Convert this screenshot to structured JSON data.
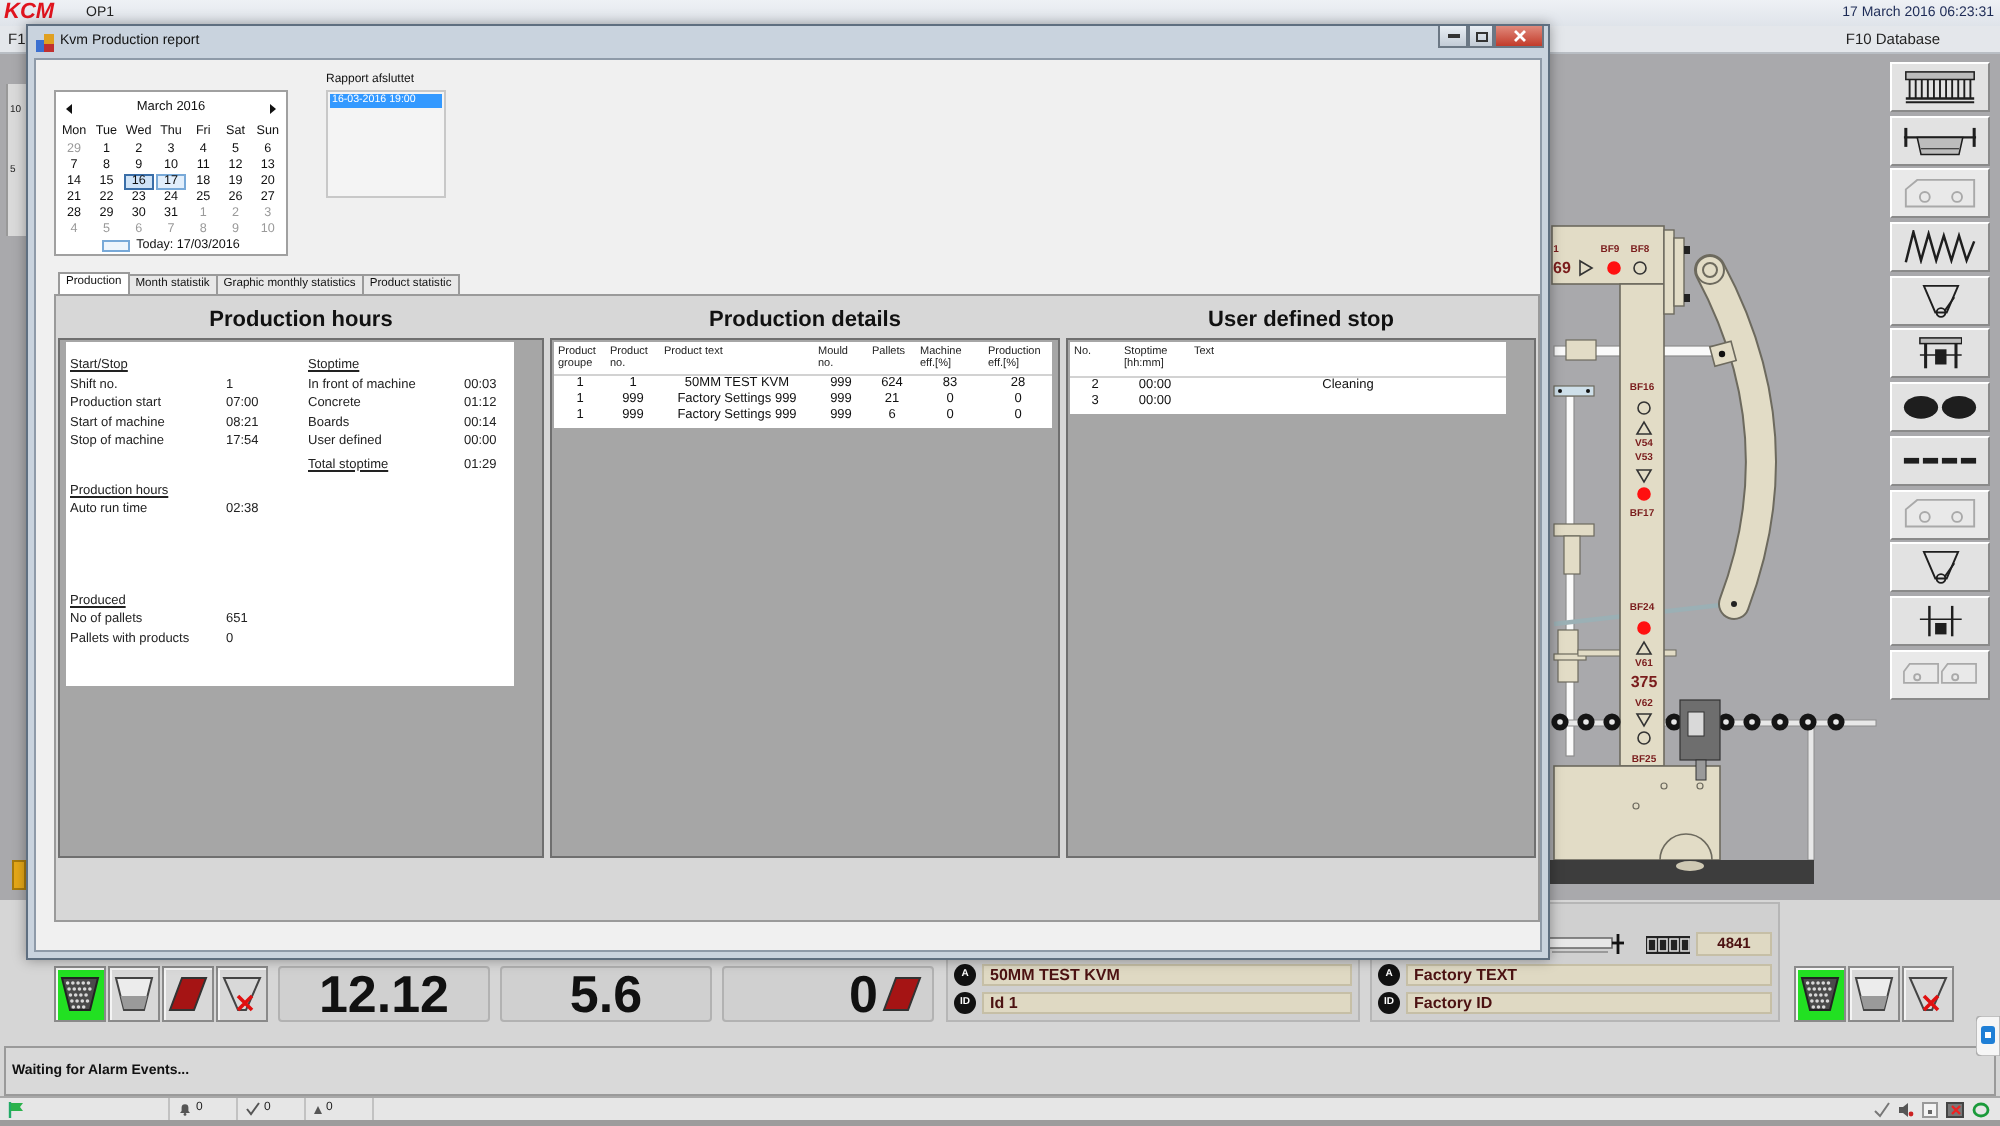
{
  "app_bar": {
    "logo": "KCM",
    "station": "OP1",
    "datetime": "17 March 2016 06:23:31"
  },
  "function_bar": {
    "left_key": "F1",
    "right_key": "F10 Database"
  },
  "dialog": {
    "title": "Kvm Production report",
    "calendar": {
      "month": "March 2016",
      "weekdays": [
        "Mon",
        "Tue",
        "Wed",
        "Thu",
        "Fri",
        "Sat",
        "Sun"
      ],
      "weeks": [
        [
          {
            "day": "29",
            "other_month": true,
            "selected": false,
            "today": false
          },
          {
            "day": "1",
            "other_month": false,
            "selected": false,
            "today": false
          },
          {
            "day": "2",
            "other_month": false,
            "selected": false,
            "today": false
          },
          {
            "day": "3",
            "other_month": false,
            "selected": false,
            "today": false
          },
          {
            "day": "4",
            "other_month": false,
            "selected": false,
            "today": false
          },
          {
            "day": "5",
            "other_month": false,
            "selected": false,
            "today": false
          },
          {
            "day": "6",
            "other_month": false,
            "selected": false,
            "today": false
          }
        ],
        [
          {
            "day": "7",
            "other_month": false,
            "selected": false,
            "today": false
          },
          {
            "day": "8",
            "other_month": false,
            "selected": false,
            "today": false
          },
          {
            "day": "9",
            "other_month": false,
            "selected": false,
            "today": false
          },
          {
            "day": "10",
            "other_month": false,
            "selected": false,
            "today": false
          },
          {
            "day": "11",
            "other_month": false,
            "selected": false,
            "today": false
          },
          {
            "day": "12",
            "other_month": false,
            "selected": false,
            "today": false
          },
          {
            "day": "13",
            "other_month": false,
            "selected": false,
            "today": false
          }
        ],
        [
          {
            "day": "14",
            "other_month": false,
            "selected": false,
            "today": false
          },
          {
            "day": "15",
            "other_month": false,
            "selected": false,
            "today": false
          },
          {
            "day": "16",
            "other_month": false,
            "selected": true,
            "today": false
          },
          {
            "day": "17",
            "other_month": false,
            "selected": false,
            "today": true
          },
          {
            "day": "18",
            "other_month": false,
            "selected": false,
            "today": false
          },
          {
            "day": "19",
            "other_month": false,
            "selected": false,
            "today": false
          },
          {
            "day": "20",
            "other_month": false,
            "selected": false,
            "today": false
          }
        ],
        [
          {
            "day": "21",
            "other_month": false,
            "selected": false,
            "today": false
          },
          {
            "day": "22",
            "other_month": false,
            "selected": false,
            "today": false
          },
          {
            "day": "23",
            "other_month": false,
            "selected": false,
            "today": false
          },
          {
            "day": "24",
            "other_month": false,
            "selected": false,
            "today": false
          },
          {
            "day": "25",
            "other_month": false,
            "selected": false,
            "today": false
          },
          {
            "day": "26",
            "other_month": false,
            "selected": false,
            "today": false
          },
          {
            "day": "27",
            "other_month": false,
            "selected": false,
            "today": false
          }
        ],
        [
          {
            "day": "28",
            "other_month": false,
            "selected": false,
            "today": false
          },
          {
            "day": "29",
            "other_month": false,
            "selected": false,
            "today": false
          },
          {
            "day": "30",
            "other_month": false,
            "selected": false,
            "today": false
          },
          {
            "day": "31",
            "other_month": false,
            "selected": false,
            "today": false
          },
          {
            "day": "1",
            "other_month": true,
            "selected": false,
            "today": false
          },
          {
            "day": "2",
            "other_month": true,
            "selected": false,
            "today": false
          },
          {
            "day": "3",
            "other_month": true,
            "selected": false,
            "today": false
          }
        ],
        [
          {
            "day": "4",
            "other_month": true,
            "selected": false,
            "today": false
          },
          {
            "day": "5",
            "other_month": true,
            "selected": false,
            "today": false
          },
          {
            "day": "6",
            "other_month": true,
            "selected": false,
            "today": false
          },
          {
            "day": "7",
            "other_month": true,
            "selected": false,
            "today": false
          },
          {
            "day": "8",
            "other_month": true,
            "selected": false,
            "today": false
          },
          {
            "day": "9",
            "other_month": true,
            "selected": false,
            "today": false
          },
          {
            "day": "10",
            "other_month": true,
            "selected": false,
            "today": false
          }
        ]
      ],
      "today": "Today: 17/03/2016"
    },
    "report_list": {
      "label": "Rapport afsluttet",
      "items": [
        {
          "text": "16-03-2016 19:00",
          "selected": true
        }
      ]
    },
    "tabs": [
      {
        "label": "Production",
        "selected": true
      },
      {
        "label": "Month statistik",
        "selected": false
      },
      {
        "label": "Graphic monthly statistics",
        "selected": false
      },
      {
        "label": "Product statistic",
        "selected": false
      }
    ],
    "production_hours": {
      "title": "Production hours",
      "left_sections": [
        {
          "heading": "Start/Stop",
          "rows": [
            {
              "label": "Shift no.",
              "value": "1"
            },
            {
              "label": "Production start",
              "value": "07:00"
            },
            {
              "label": "Start of machine",
              "value": "08:21"
            },
            {
              "label": "Stop of machine",
              "value": "17:54"
            }
          ]
        },
        {
          "heading": "Production hours",
          "rows": [
            {
              "label": "Auto run time",
              "value": "02:38"
            }
          ]
        },
        {
          "heading": "Produced",
          "rows": [
            {
              "label": "No of pallets",
              "value": "651"
            },
            {
              "label": "Pallets with products",
              "value": "0"
            }
          ]
        }
      ],
      "right_sections": [
        {
          "heading": "Stoptime",
          "rows": [
            {
              "label": "In front of machine",
              "value": "00:03"
            },
            {
              "label": "Concrete",
              "value": "01:12"
            },
            {
              "label": "Boards",
              "value": "00:14"
            },
            {
              "label": "User defined",
              "value": "00:00"
            }
          ]
        }
      ],
      "total": {
        "label": "Total stoptime",
        "value": "01:29"
      }
    },
    "production_details": {
      "title": "Production details",
      "columns": [
        "Product groupe",
        "Product no.",
        "Product text",
        "Mould no.",
        "Pallets",
        "Machine eff.[%]",
        "Production eff.[%]"
      ],
      "rows": [
        [
          "1",
          "1",
          "50MM TEST KVM",
          "999",
          "624",
          "83",
          "28"
        ],
        [
          "1",
          "999",
          "Factory Settings 999",
          "999",
          "21",
          "0",
          "0"
        ],
        [
          "1",
          "999",
          "Factory Settings 999",
          "999",
          "6",
          "0",
          "0"
        ]
      ]
    },
    "user_defined_stop": {
      "title": "User defined stop",
      "columns": [
        "No.",
        "Stoptime [hh:mm]",
        "Text"
      ],
      "rows": [
        [
          "2",
          "00:00",
          "Cleaning"
        ],
        [
          "3",
          "00:00"
        ]
      ]
    }
  },
  "trend_axis": [
    "10",
    "5"
  ],
  "machine": {
    "readings": [
      "1",
      "69",
      "375"
    ],
    "sensors": [
      {
        "label": "BF9",
        "active": true
      },
      {
        "label": "BF8",
        "active": false
      },
      {
        "label": "BF16",
        "active": false
      },
      {
        "label": "BF17",
        "active": true
      },
      {
        "label": "BF24",
        "active": true
      },
      {
        "label": "BF25",
        "active": false
      }
    ],
    "valves": [
      {
        "kind": "right"
      },
      {
        "label": "V54",
        "kind": "up"
      },
      {
        "label": "V53",
        "kind": "down"
      },
      {
        "label": "V61",
        "kind": "up"
      },
      {
        "label": "V62",
        "kind": "down"
      }
    ]
  },
  "side_toolbar": [
    {
      "kind": "rack",
      "disabled": false
    },
    {
      "kind": "mould",
      "disabled": false
    },
    {
      "kind": "cart",
      "disabled": true
    },
    {
      "kind": "zigzag",
      "disabled": false
    },
    {
      "kind": "hopper",
      "disabled": false
    },
    {
      "kind": "press",
      "disabled": false
    },
    {
      "kind": "pads",
      "disabled": false
    },
    {
      "kind": "dashes",
      "disabled": false
    },
    {
      "kind": "cart",
      "disabled": true
    },
    {
      "kind": "hopper",
      "disabled": false
    },
    {
      "kind": "frame",
      "disabled": false
    },
    {
      "kind": "carts",
      "disabled": true
    }
  ],
  "bottom": {
    "mode_buttons_left": [
      {
        "kind": "full_basket",
        "selected": true
      },
      {
        "kind": "empty_basket",
        "selected": false
      },
      {
        "kind": "board",
        "selected": false
      },
      {
        "kind": "reject_basket",
        "selected": false
      }
    ],
    "counters": [
      {
        "kind": "plain",
        "value": "12.12"
      },
      {
        "kind": "plain",
        "value": "5.6"
      },
      {
        "kind": "boards",
        "value": "0"
      }
    ],
    "product_info": [
      {
        "badge": "A",
        "text": "50MM TEST KVM"
      },
      {
        "badge": "ID",
        "text": "Id 1"
      }
    ],
    "factory_info": {
      "counter": "4841",
      "rows": [
        {
          "badge": "A",
          "text": "Factory TEXT"
        },
        {
          "badge": "ID",
          "text": "Factory ID"
        }
      ]
    },
    "mode_buttons_right": [
      {
        "kind": "full_basket",
        "selected": true
      },
      {
        "kind": "empty_basket",
        "selected": false
      },
      {
        "kind": "reject_basket",
        "selected": false
      }
    ]
  },
  "alarm_pane": {
    "message": "Waiting for Alarm Events..."
  },
  "status_bar": {
    "counters": [
      {
        "kind": "bell",
        "value": "0"
      },
      {
        "kind": "tick",
        "value": "0"
      },
      {
        "kind": "triangle",
        "value": "0"
      }
    ]
  }
}
